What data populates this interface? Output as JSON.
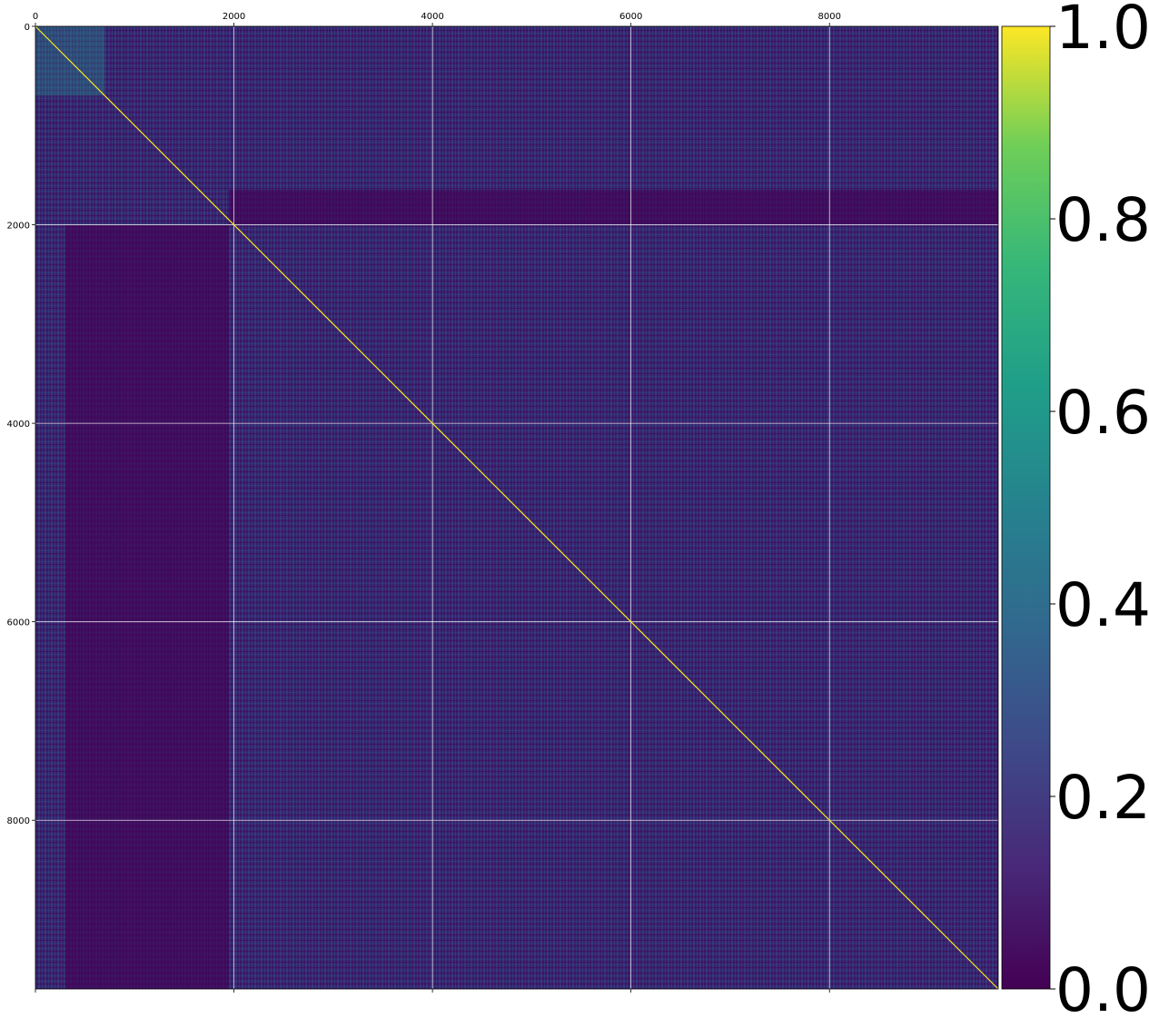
{
  "chart_data": {
    "type": "heatmap",
    "title": "",
    "xlabel": "",
    "ylabel": "",
    "matrix_size": 9700,
    "xlim": [
      0,
      9700
    ],
    "ylim": [
      9700,
      0
    ],
    "x_ticks": [
      0,
      2000,
      4000,
      6000,
      8000
    ],
    "y_ticks": [
      0,
      2000,
      4000,
      6000,
      8000
    ],
    "x_tick_labels": [
      "0",
      "2000",
      "4000",
      "6000",
      "8000"
    ],
    "y_tick_labels": [
      "0",
      "2000",
      "4000",
      "6000",
      "8000"
    ],
    "x_ticks_position": "top",
    "grid": true,
    "colormap": "viridis",
    "colormap_stops": [
      "#440154",
      "#3b528b",
      "#21918c",
      "#5ec962",
      "#fde725"
    ],
    "background_value_color": "#3a1c6b",
    "diagonal": {
      "value": 1.0,
      "color": "#fde725"
    },
    "regions": [
      {
        "note": "low block columns",
        "x_range": [
          300,
          1950
        ],
        "y_range": [
          2000,
          9700
        ],
        "level": 0.03
      },
      {
        "note": "low block rows",
        "x_range": [
          1950,
          9700
        ],
        "y_range": [
          1650,
          2000
        ],
        "level": 0.03
      },
      {
        "note": "higher block",
        "x_range": [
          0,
          700
        ],
        "y_range": [
          0,
          700
        ],
        "level": 0.3
      }
    ],
    "colorbar": {
      "min": 0.0,
      "max": 1.0,
      "ticks": [
        0.0,
        0.2,
        0.4,
        0.6,
        0.8,
        1.0
      ],
      "tick_labels": [
        "0.0",
        "0.2",
        "0.4",
        "0.6",
        "0.8",
        "1.0"
      ]
    }
  }
}
